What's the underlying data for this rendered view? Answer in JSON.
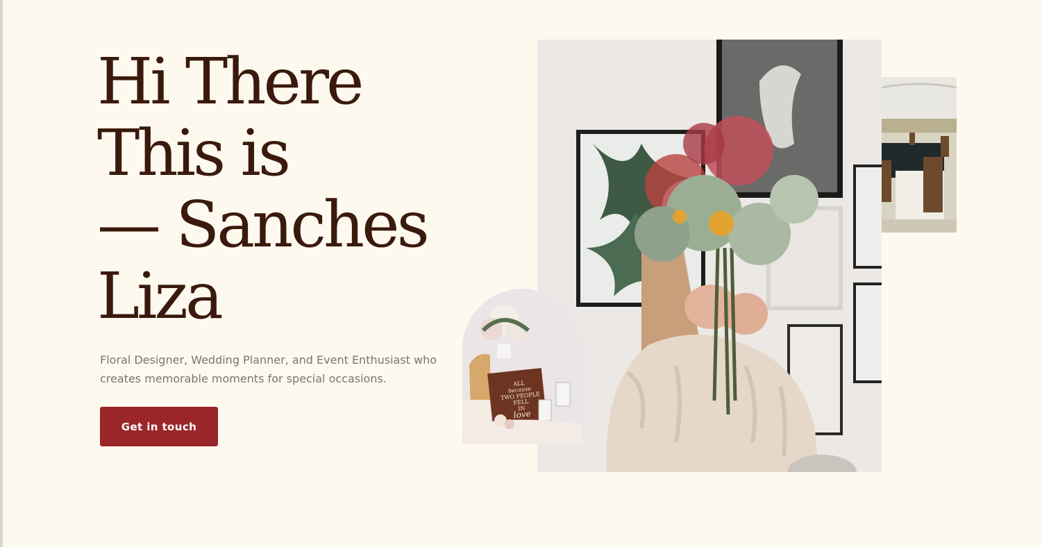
{
  "hero": {
    "title_lines": [
      "Hi There",
      "This is",
      "— Sanches",
      "Liza"
    ],
    "subtitle": "Floral Designer, Wedding Planner, and Event Enthusiast who creates memorable moments for special occasions.",
    "cta_label": "Get in touch"
  },
  "images": {
    "arch_sign_lines": [
      "ALL",
      "because",
      "TWO PEOPLE",
      "FELL",
      "IN",
      "love"
    ]
  },
  "colors": {
    "background": "#fef9ef",
    "heading": "#3a1a0c",
    "body_text": "#7b7470",
    "accent": "#9b262a"
  }
}
